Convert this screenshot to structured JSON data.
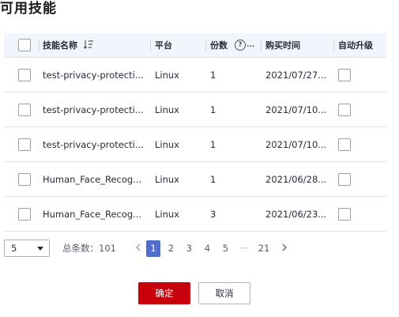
{
  "title": "可用技能",
  "table": {
    "headers": {
      "name": "技能名称",
      "platform": "平台",
      "count": "份数",
      "count_help": "?",
      "count_more": "...",
      "purchase_time": "购买时间",
      "auto_upgrade": "自动升级"
    },
    "rows": [
      {
        "name": "test-privacy-protecti...",
        "platform": "Linux",
        "count": "1",
        "purchase_time": "2021/07/27..."
      },
      {
        "name": "test-privacy-protecti...",
        "platform": "Linux",
        "count": "1",
        "purchase_time": "2021/07/10..."
      },
      {
        "name": "test-privacy-protecti...",
        "platform": "Linux",
        "count": "1",
        "purchase_time": "2021/07/10..."
      },
      {
        "name": "Human_Face_Recog...",
        "platform": "Linux",
        "count": "1",
        "purchase_time": "2021/06/28..."
      },
      {
        "name": "Human_Face_Recog...",
        "platform": "Linux",
        "count": "3",
        "purchase_time": "2021/06/23..."
      }
    ]
  },
  "pagination": {
    "page_size": "5",
    "total_label": "总条数：101",
    "pages": [
      "1",
      "2",
      "3",
      "4",
      "5",
      "···",
      "21"
    ],
    "current_page": "1"
  },
  "buttons": {
    "ok": "确定",
    "cancel": "取消"
  },
  "colors": {
    "primary": "#c7000b",
    "active_page": "#526ecc",
    "header_bg": "#f2f5fc"
  }
}
